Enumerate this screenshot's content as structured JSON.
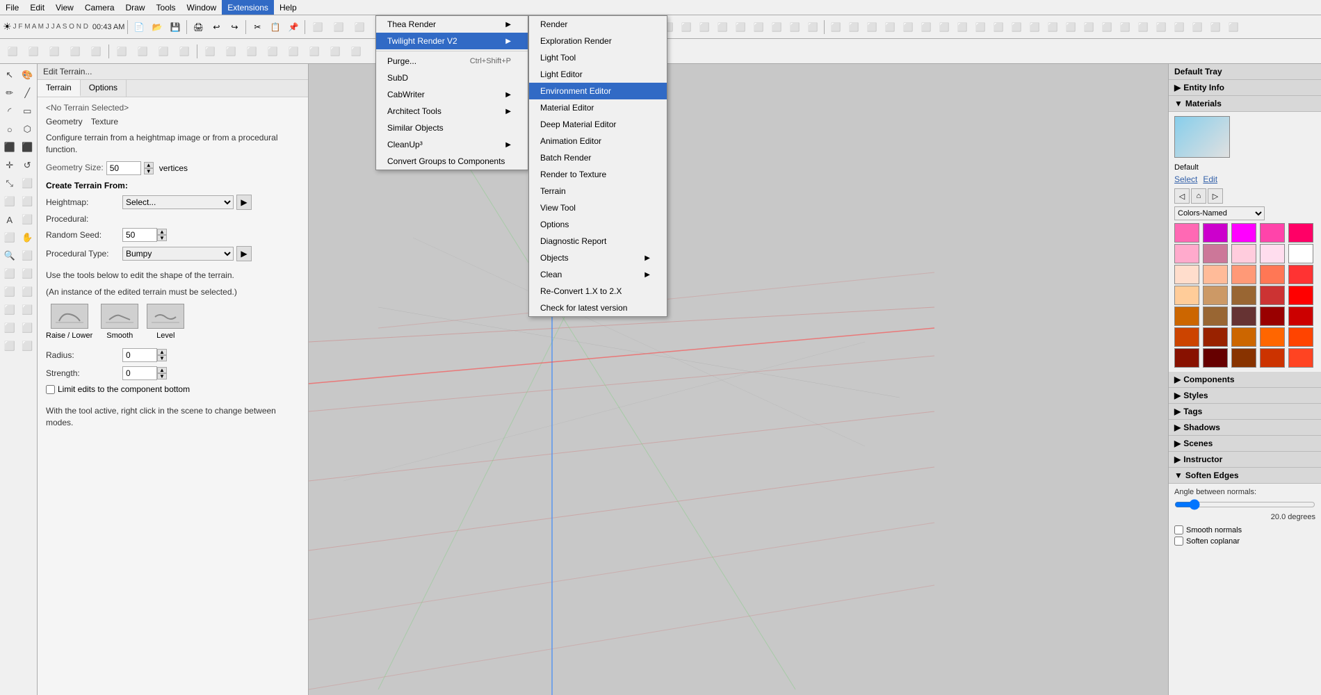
{
  "menubar": {
    "items": [
      "File",
      "Edit",
      "View",
      "Camera",
      "Draw",
      "Tools",
      "Window",
      "Extensions",
      "Help"
    ]
  },
  "extensions_menu": {
    "items": [
      {
        "label": "Thea Render",
        "has_submenu": true
      },
      {
        "label": "Twilight Render V2",
        "has_submenu": true,
        "active": true
      },
      {
        "label": "Purge...",
        "shortcut": "Ctrl+Shift+P"
      },
      {
        "label": "SubD"
      },
      {
        "label": "CabWriter",
        "has_submenu": true
      },
      {
        "label": "Architect Tools",
        "has_submenu": true
      },
      {
        "label": "Similar Objects"
      },
      {
        "label": "CleanUp³",
        "has_submenu": true
      },
      {
        "label": "Convert Groups to Components"
      }
    ]
  },
  "twilight_submenu": {
    "items": [
      {
        "label": "Render"
      },
      {
        "label": "Exploration Render"
      },
      {
        "label": "Light Tool"
      },
      {
        "label": "Light Editor"
      },
      {
        "label": "Environment Editor",
        "highlighted": true
      },
      {
        "label": "Material Editor"
      },
      {
        "label": "Deep Material Editor"
      },
      {
        "label": "Animation Editor"
      },
      {
        "label": "Batch Render"
      },
      {
        "label": "Render to Texture"
      },
      {
        "label": "Terrain"
      },
      {
        "label": "View Tool"
      },
      {
        "label": "Options"
      },
      {
        "label": "Diagnostic Report"
      },
      {
        "label": "Objects",
        "has_submenu": true
      },
      {
        "label": "Clean",
        "has_submenu": true
      },
      {
        "label": "Re-Convert 1.X to 2.X"
      },
      {
        "label": "Check for latest version"
      }
    ]
  },
  "terrain_panel": {
    "header": "Edit Terrain...",
    "tabs": [
      "Terrain",
      "Options"
    ],
    "subtitle": "<No Terrain Selected>",
    "geometry_label": "Geometry",
    "texture_label": "Texture",
    "description": "Configure terrain from a heightmap image or from a procedural function.",
    "geometry_size_label": "Geometry Size:",
    "geometry_size_value": "50",
    "vertices_label": "vertices",
    "create_from_label": "Create Terrain From:",
    "heightmap_label": "Heightmap:",
    "heightmap_select": "Select...",
    "procedural_label": "Procedural:",
    "random_seed_label": "Random Seed:",
    "random_seed_value": "50",
    "procedural_type_label": "Procedural Type:",
    "procedural_type_value": "Bumpy",
    "edit_desc1": "Use the tools below to edit the shape of the terrain.",
    "edit_desc2": "(An instance of the edited terrain must be selected.)",
    "tools": [
      {
        "label": "Raise / Lower"
      },
      {
        "label": "Smooth"
      },
      {
        "label": "Level"
      }
    ],
    "radius_label": "Radius:",
    "radius_value": "0",
    "strength_label": "Strength:",
    "strength_value": "0",
    "checkbox_label": "Limit edits to the component bottom",
    "hint": "With the tool active, right click in the scene to change between modes."
  },
  "right_panel": {
    "default_tray_label": "Default Tray",
    "entity_info_label": "Entity Info",
    "materials_label": "Materials",
    "default_mat_label": "Default",
    "select_label": "Select",
    "edit_label": "Edit",
    "colors_named": "Colors-Named",
    "swatches": [
      "#ff69b4",
      "#cc00cc",
      "#ff00ff",
      "#ff44aa",
      "#ff0066",
      "#ffaacc",
      "#cc7799",
      "#ffccdd",
      "#ffddee",
      "#ffffff",
      "#ffddcc",
      "#ffbb99",
      "#ff9977",
      "#ff7755",
      "#ff3333",
      "#ffcc99",
      "#cc9966",
      "#996633",
      "#cc3333",
      "#ff0000",
      "#cc6600",
      "#996633",
      "#663333",
      "#990000",
      "#cc0000",
      "#cc4400",
      "#992200",
      "#cc6600",
      "#ff6600",
      "#ff4400",
      "#881100",
      "#660000",
      "#883300",
      "#cc3300",
      "#ff4422"
    ],
    "components_label": "Components",
    "styles_label": "Styles",
    "tags_label": "Tags",
    "shadows_label": "Shadows",
    "scenes_label": "Scenes",
    "instructor_label": "Instructor",
    "soften_edges_label": "Soften Edges",
    "angle_label": "Angle between normals:",
    "angle_value": "20.0  degrees",
    "smooth_normals_label": "Smooth normals",
    "soften_coplanar_label": "Soften coplanar"
  },
  "toolbar": {
    "time": "00:43 AM",
    "months": "J  F  M  A  M  J  J  A  S  O  N  D"
  }
}
